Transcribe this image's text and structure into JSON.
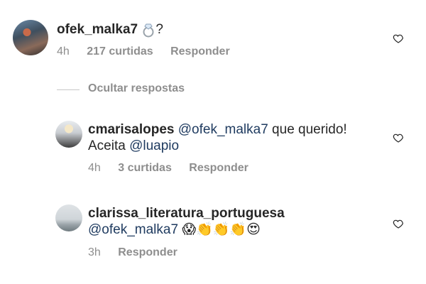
{
  "comments": [
    {
      "username": "ofek_malka7",
      "text_after_emoji": "?",
      "ring_emoji": "💍",
      "time": "4h",
      "likes": "217 curtidas",
      "reply_label": "Responder"
    },
    {
      "username": "cmarisalopes",
      "mention1": "@ofek_malka7",
      "text1": " que querido!",
      "text2_prefix": "Aceita ",
      "mention2": "@luapio",
      "time": "4h",
      "likes": "3 curtidas",
      "reply_label": "Responder"
    },
    {
      "username": "clarissa_literatura_portuguesa",
      "mention": "@ofek_malka7",
      "emojis": "😱👏👏👏😍",
      "time": "3h",
      "reply_label": "Responder"
    }
  ],
  "hide_replies_label": "Ocultar respostas",
  "icons": {
    "like": "heart-outline-icon"
  },
  "colors": {
    "text": "#262626",
    "meta": "#8e8e8e",
    "mention": "#1e3a5f"
  }
}
